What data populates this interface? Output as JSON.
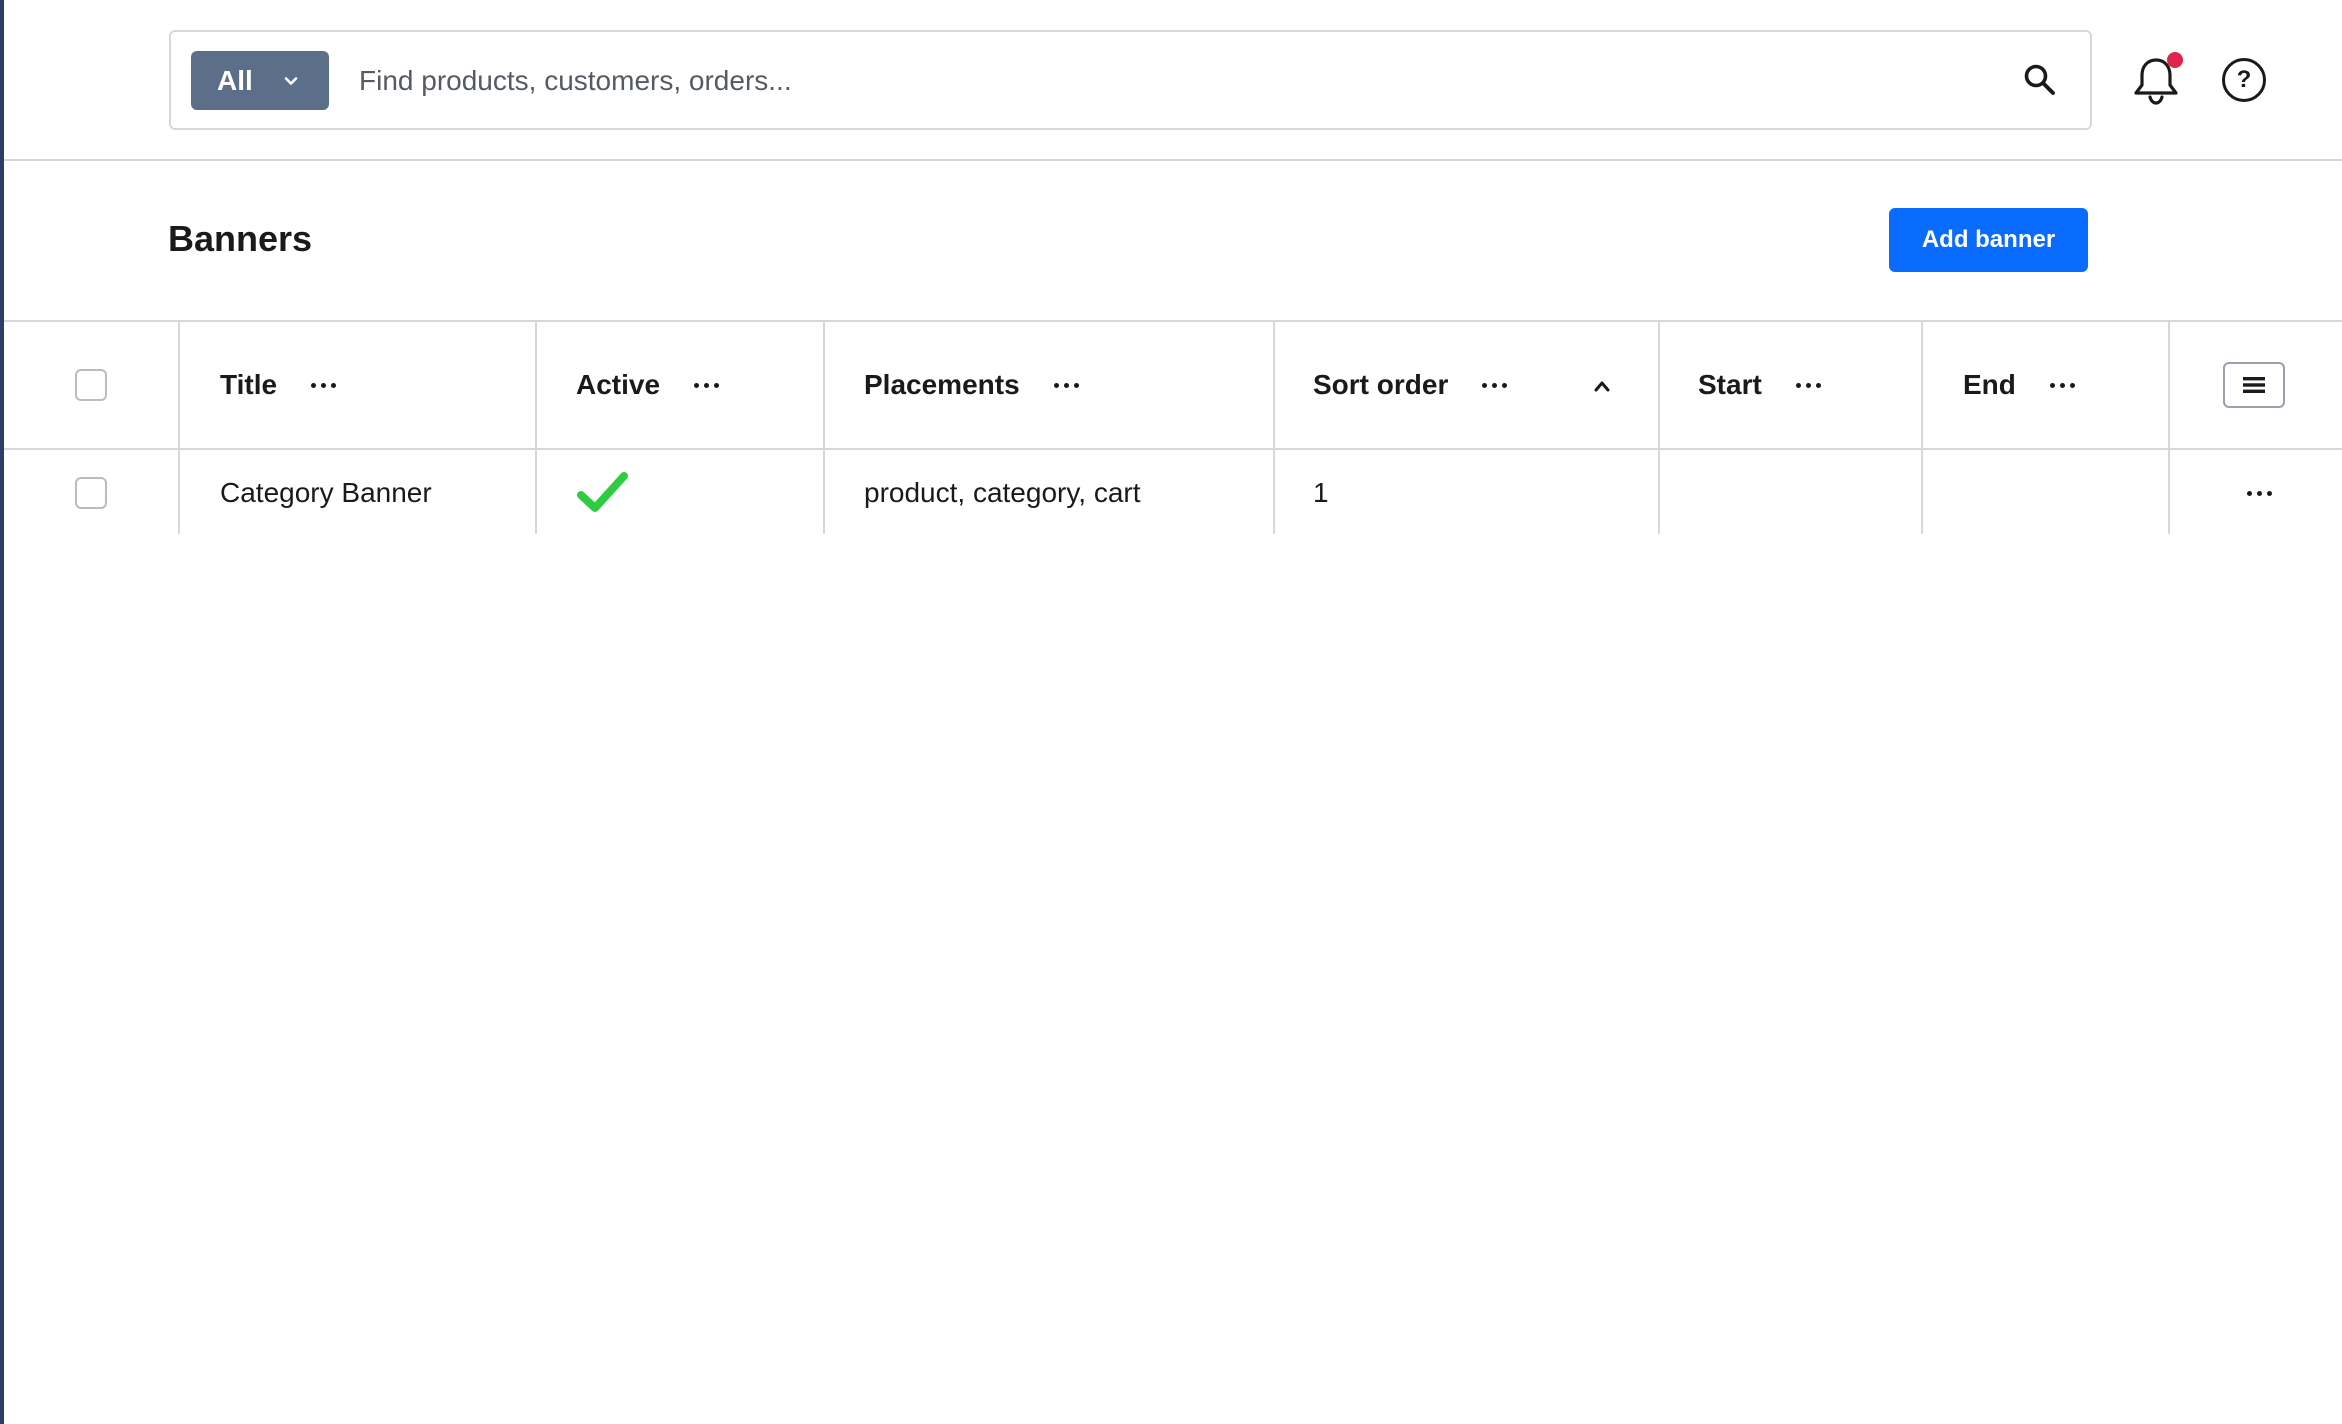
{
  "search": {
    "scope_label": "All",
    "placeholder": "Find products, customers, orders..."
  },
  "page": {
    "title": "Banners",
    "add_button_label": "Add banner"
  },
  "table": {
    "columns": [
      "Title",
      "Active",
      "Placements",
      "Sort order",
      "Start",
      "End"
    ],
    "sorted_column": "Sort order",
    "sort_direction": "ascending",
    "rows": [
      {
        "title": "Category Banner",
        "active": true,
        "placements": "product, category, cart",
        "sort_order": "1",
        "start": "",
        "end": ""
      }
    ]
  },
  "colors": {
    "accent": "#0a6cff",
    "scope_select_bg": "#5b7088",
    "notification_dot": "#e0254a",
    "active_check": "#2ecc40",
    "left_rail": "#2c3e63"
  },
  "icons": {
    "search": "search-icon",
    "scope_chevron": "chevron-down-icon",
    "notifications": "bell-icon",
    "help": "help-circle-icon",
    "column_menu": "more-horizontal-icon",
    "sort": "chevron-up-icon",
    "table_columns": "menu-icon",
    "active": "checkmark-icon"
  }
}
